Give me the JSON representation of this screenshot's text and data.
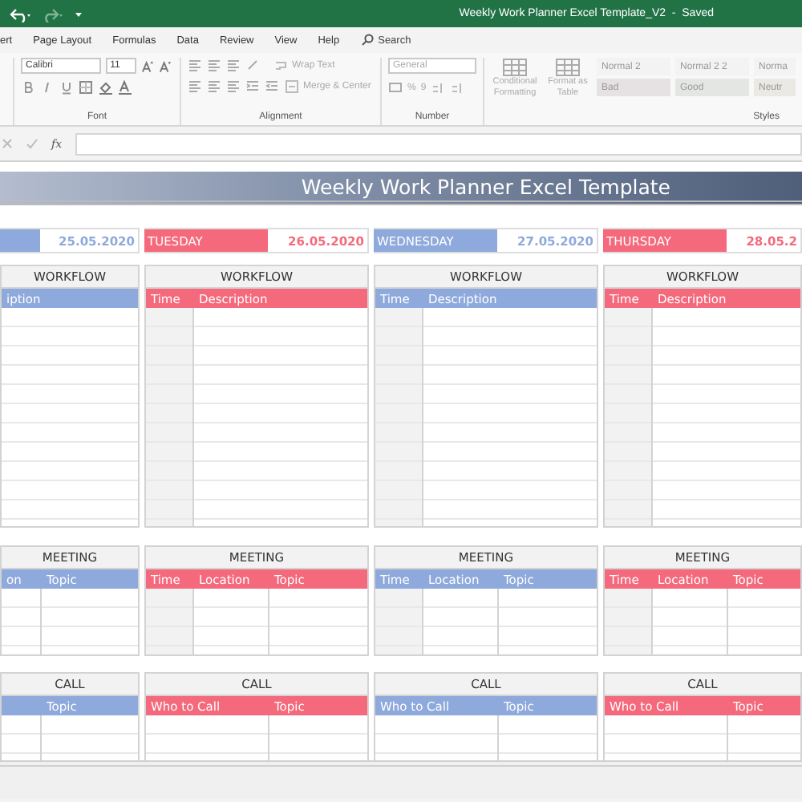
{
  "window": {
    "title": "Weekly Work Planner Excel Template_V2  -  Saved"
  },
  "menu": [
    "ert",
    "Page Layout",
    "Formulas",
    "Data",
    "Review",
    "View",
    "Help"
  ],
  "search": {
    "placeholder": "Search"
  },
  "ribbon": {
    "font_name": "Calibri",
    "font_size": "11",
    "wrap_text": "Wrap Text",
    "merge_center": "Merge & Center",
    "number_format": "General",
    "percent": "%",
    "comma": "9",
    "conditional_formatting": "Conditional Formatting",
    "format_as_table": "Format as Table",
    "styles": [
      {
        "label": "Normal 2",
        "color": "#f3f3f3"
      },
      {
        "label": "Normal 2 2",
        "color": "#f3f3f3"
      },
      {
        "label": "Norma",
        "color": "#f3f3f3"
      },
      {
        "label": "Bad",
        "color": "#e6e2e4"
      },
      {
        "label": "Good",
        "color": "#e4e6e4"
      },
      {
        "label": "Neutr",
        "color": "#ebe9e4"
      }
    ],
    "groups": [
      {
        "label": "Font"
      },
      {
        "label": "Alignment"
      },
      {
        "label": "Number"
      },
      {
        "label": "Styles"
      }
    ]
  },
  "formula_bar": {
    "function_label": "fx"
  },
  "sheet": {
    "title": "Weekly Work Planner Excel Template",
    "days": [
      {
        "date": "25.05.2020",
        "color": "#8ea9db",
        "workflow": {
          "title": "WORKFLOW",
          "columns": [
            {
              "kind": "description",
              "label": "iption"
            }
          ]
        },
        "meeting": {
          "title": "MEETING",
          "columns": [
            {
              "kind": "partial",
              "label": "on"
            },
            {
              "kind": "topic",
              "label": "Topic"
            }
          ]
        },
        "call": {
          "title": "CALL",
          "columns": [
            {
              "kind": "partial"
            },
            {
              "kind": "topic",
              "label": "Topic"
            }
          ]
        }
      },
      {
        "name": "TUESDAY",
        "date": "26.05.2020",
        "color": "#f4697b",
        "workflow": {
          "title": "WORKFLOW",
          "columns": [
            {
              "kind": "time",
              "label": "Time"
            },
            {
              "kind": "description",
              "label": "Description"
            }
          ]
        },
        "meeting": {
          "title": "MEETING",
          "columns": [
            {
              "kind": "time",
              "label": "Time"
            },
            {
              "kind": "location",
              "label": "Location"
            },
            {
              "kind": "topic",
              "label": "Topic"
            }
          ]
        },
        "call": {
          "title": "CALL",
          "columns": [
            {
              "kind": "who",
              "label": "Who to Call"
            },
            {
              "kind": "topic",
              "label": "Topic"
            }
          ]
        }
      },
      {
        "name": "WEDNESDAY",
        "date": "27.05.2020",
        "color": "#8ea9db",
        "workflow": {
          "title": "WORKFLOW",
          "columns": [
            {
              "kind": "time",
              "label": "Time"
            },
            {
              "kind": "description",
              "label": "Description"
            }
          ]
        },
        "meeting": {
          "title": "MEETING",
          "columns": [
            {
              "kind": "time",
              "label": "Time"
            },
            {
              "kind": "location",
              "label": "Location"
            },
            {
              "kind": "topic",
              "label": "Topic"
            }
          ]
        },
        "call": {
          "title": "CALL",
          "columns": [
            {
              "kind": "who",
              "label": "Who to Call"
            },
            {
              "kind": "topic",
              "label": "Topic"
            }
          ]
        }
      },
      {
        "name": "THURSDAY",
        "date": "28.05.2",
        "color": "#f4697b",
        "workflow": {
          "title": "WORKFLOW",
          "columns": [
            {
              "kind": "time",
              "label": "Time"
            },
            {
              "kind": "description",
              "label": "Description"
            }
          ]
        },
        "meeting": {
          "title": "MEETING",
          "columns": [
            {
              "kind": "time",
              "label": "Time"
            },
            {
              "kind": "location",
              "label": "Location"
            },
            {
              "kind": "topic",
              "label": "Topic"
            }
          ]
        },
        "call": {
          "title": "CALL",
          "columns": [
            {
              "kind": "who",
              "label": "Who to Call"
            },
            {
              "kind": "topic",
              "label": "Topic"
            }
          ]
        }
      }
    ]
  }
}
